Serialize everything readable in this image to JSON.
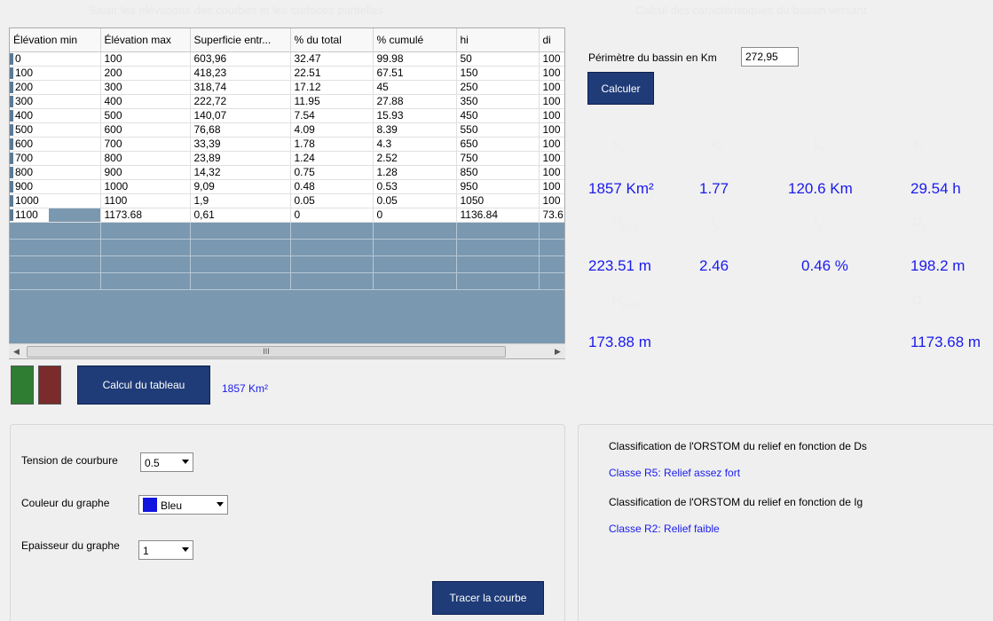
{
  "sections": {
    "left_title": "Saisir les élévations des courbes et les surfaces partielles",
    "right_title": "Calcul des caractéristiques du bassin versant"
  },
  "grid": {
    "columns": [
      "Élévation min",
      "Élévation max",
      "Superficie entr...",
      "% du total",
      "% cumulé",
      "hi",
      "di"
    ],
    "rows": [
      [
        "0",
        "100",
        "603,96",
        "32.47",
        "99.98",
        "50",
        "100"
      ],
      [
        "100",
        "200",
        "418,23",
        "22.51",
        "67.51",
        "150",
        "100"
      ],
      [
        "200",
        "300",
        "318,74",
        "17.12",
        "45",
        "250",
        "100"
      ],
      [
        "300",
        "400",
        "222,72",
        "11.95",
        "27.88",
        "350",
        "100"
      ],
      [
        "400",
        "500",
        "140,07",
        "7.54",
        "15.93",
        "450",
        "100"
      ],
      [
        "500",
        "600",
        "76,68",
        "4.09",
        "8.39",
        "550",
        "100"
      ],
      [
        "600",
        "700",
        "33,39",
        "1.78",
        "4.3",
        "650",
        "100"
      ],
      [
        "700",
        "800",
        "23,89",
        "1.24",
        "2.52",
        "750",
        "100"
      ],
      [
        "800",
        "900",
        "14,32",
        "0.75",
        "1.28",
        "850",
        "100"
      ],
      [
        "900",
        "1000",
        "9,09",
        "0.48",
        "0.53",
        "950",
        "100"
      ],
      [
        "1000",
        "1100",
        "1,9",
        "0.05",
        "0.05",
        "1050",
        "100"
      ],
      [
        "1100",
        "1173.68",
        "0,61",
        "0",
        "0",
        "1136.84",
        "73.6"
      ]
    ],
    "scroll_thumb": "III"
  },
  "colors": {
    "green": "#2e7d32",
    "red": "#7b2b2b",
    "button": "#1f3c78",
    "value": "#1a1aee"
  },
  "calc_table": {
    "label": "Calcul du tableau",
    "result": "1857 Km²"
  },
  "options": {
    "tension_label": "Tension de courbure",
    "tension_value": "0.5",
    "color_label": "Couleur du graphe",
    "color_value": "Bleu",
    "thickness_label": "Epaisseur du graphe",
    "thickness_value": "1",
    "trace_button": "Tracer la courbe"
  },
  "perimeter": {
    "label": "Périmètre du bassin en Km",
    "value": "272,95",
    "calc_button": "Calculer"
  },
  "stats": {
    "st_label": "S",
    "st_sub": "t",
    "st_value": "1857 Km²",
    "kc_label": "K",
    "kc_sub": "c",
    "kc_value": "1.77",
    "lp_label": "L",
    "lp_sub": "p",
    "lp_value": "120.6 Km",
    "tc_label": "T",
    "tc_sub": "c",
    "tc_value": "29.54 h",
    "hmoy_label": "H",
    "hmoy_sub": "moy",
    "hmoy_value": "223.51 m",
    "ip_label": "I",
    "ip_sub": "p",
    "ip_value": "2.46",
    "ig_label": "I",
    "ig_sub": "g",
    "ig_value": "0.46 %",
    "ds_label": "D",
    "ds_sub": "s",
    "ds_value": "198.2 m",
    "hmed_label": "H",
    "hmed_sub": "med",
    "hmed_value": "173.88 m",
    "d_label": "D",
    "d_value": "1173.68 m"
  },
  "classification": {
    "ds_title": "Classification de l'ORSTOM du relief en fonction de Ds",
    "ds_result": "Classe R5: Relief assez fort",
    "ig_title": "Classification de l'ORSTOM du relief en fonction de Ig",
    "ig_result": "Classe R2: Relief faible"
  }
}
